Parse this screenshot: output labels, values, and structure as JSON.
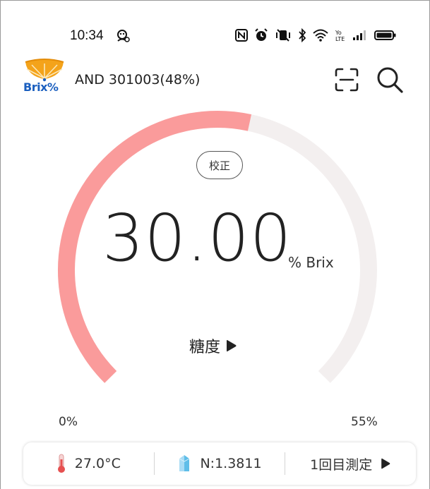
{
  "status_bar": {
    "time": "10:34"
  },
  "app_bar": {
    "logo_text": "Brix%",
    "device_name": "AND 301003(48%)"
  },
  "gauge": {
    "calibrate_label": "校正",
    "reading": "30.00",
    "unit": "% Brix",
    "mode_label": "糖度",
    "scale_min": "0%",
    "scale_max": "55%",
    "min_value": 0,
    "max_value": 55,
    "value": 30.0,
    "fill_color": "#fa9b9b",
    "track_color": "#f3efef"
  },
  "info_bar": {
    "temperature": "27.0°C",
    "refractive_index": "N:1.3811",
    "measurement_label": "1回目測定"
  }
}
